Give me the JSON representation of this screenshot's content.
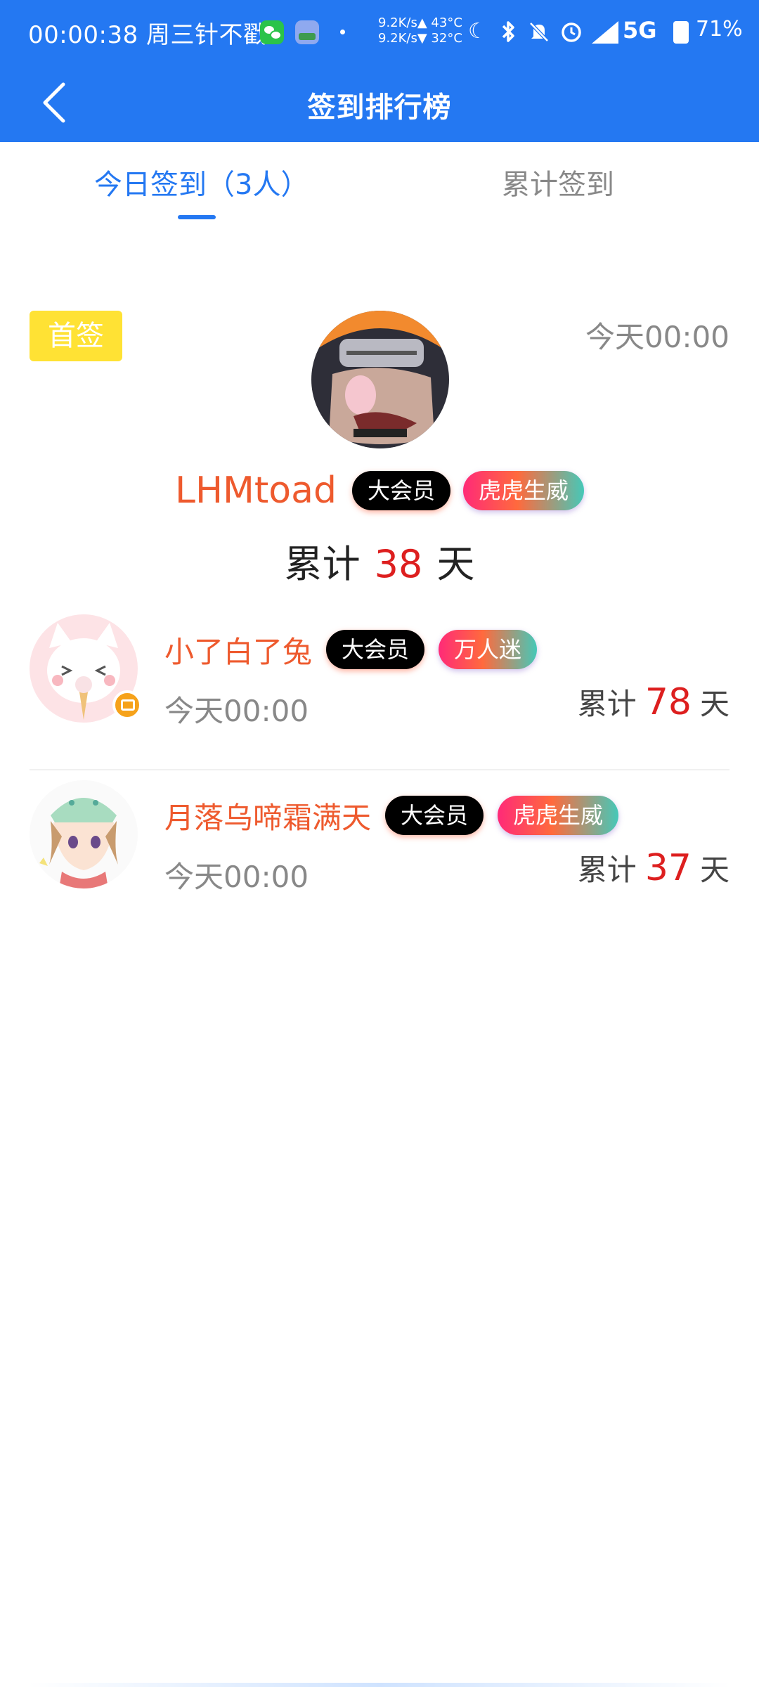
{
  "status_bar": {
    "time": "00:00:38 周三针不戳",
    "net_up": "9.2K/s▲ 43°C",
    "net_down": "9.2K/s▼ 32°C",
    "network": "5G",
    "battery": "71%"
  },
  "header": {
    "title": "签到排行榜"
  },
  "tabs": [
    {
      "label": "今日签到（3人）"
    },
    {
      "label": "累计签到"
    }
  ],
  "top_entry": {
    "badge": "首签",
    "time": "今天00:00",
    "name": "LHMtoad",
    "tags": [
      "大会员",
      "虎虎生威"
    ],
    "total_prefix": "累计",
    "total_days": "38",
    "total_suffix": "天"
  },
  "entries": [
    {
      "name": "小了白了兔",
      "tags": [
        "大会员",
        "万人迷"
      ],
      "time": "今天00:00",
      "total_prefix": "累计",
      "total_days": "78",
      "total_suffix": "天"
    },
    {
      "name": "月落乌啼霜满天",
      "tags": [
        "大会员",
        "虎虎生威"
      ],
      "time": "今天00:00",
      "total_prefix": "累计",
      "total_days": "37",
      "total_suffix": "天"
    }
  ]
}
